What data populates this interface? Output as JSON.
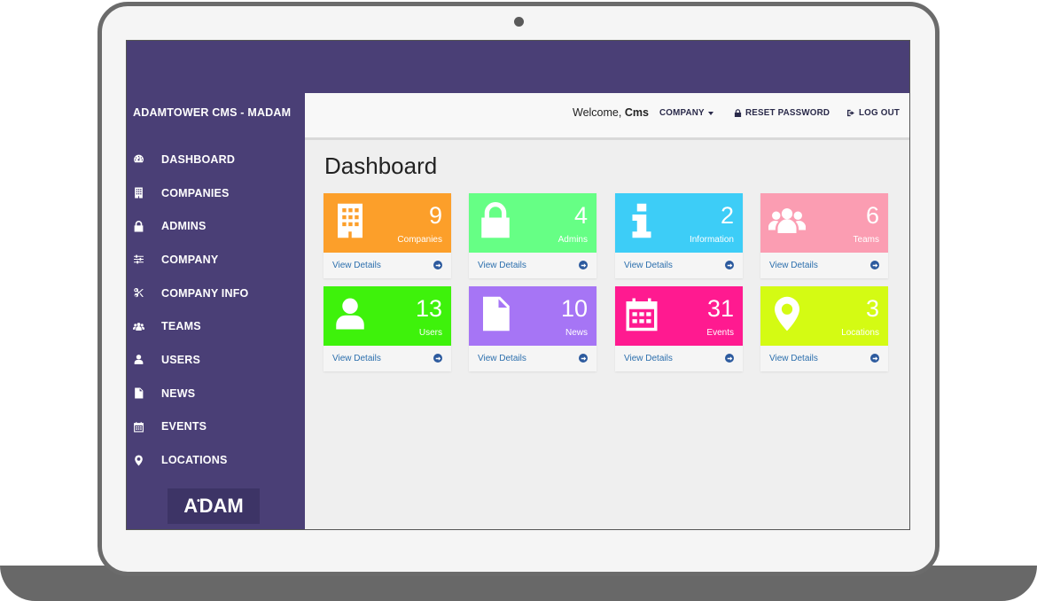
{
  "app": {
    "brand": "ADAMTOWER CMS - MADAM",
    "logo_text_left": "A",
    "logo_dot": "•",
    "logo_text_right": "DAM"
  },
  "sidebar": {
    "items": [
      {
        "label": "DASHBOARD",
        "icon": "dashboard-icon"
      },
      {
        "label": "COMPANIES",
        "icon": "building-icon"
      },
      {
        "label": "ADMINS",
        "icon": "lock-icon"
      },
      {
        "label": "COMPANY",
        "icon": "sliders-icon"
      },
      {
        "label": "COMPANY INFO",
        "icon": "scissors-icon"
      },
      {
        "label": "TEAMS",
        "icon": "users-icon"
      },
      {
        "label": "USERS",
        "icon": "user-icon"
      },
      {
        "label": "NEWS",
        "icon": "document-icon"
      },
      {
        "label": "EVENTS",
        "icon": "calendar-icon"
      },
      {
        "label": "LOCATIONS",
        "icon": "map-marker-icon"
      }
    ]
  },
  "header": {
    "welcome_prefix": "Welcome,",
    "welcome_user": "Cms",
    "company_menu": "COMPANY",
    "reset_password": "RESET PASSWORD",
    "logout": "LOG OUT"
  },
  "main": {
    "title": "Dashboard",
    "cards": [
      {
        "count": "9",
        "label": "Companies",
        "link": "View Details",
        "color": "#fc9f2a",
        "icon": "building-icon"
      },
      {
        "count": "4",
        "label": "Admins",
        "link": "View Details",
        "color": "#66ff85",
        "icon": "lock-icon"
      },
      {
        "count": "2",
        "label": "Information",
        "link": "View Details",
        "color": "#3dcdf7",
        "icon": "info-icon"
      },
      {
        "count": "6",
        "label": "Teams",
        "link": "View Details",
        "color": "#fb9db2",
        "icon": "users-icon"
      },
      {
        "count": "13",
        "label": "Users",
        "link": "View Details",
        "color": "#3ef20b",
        "icon": "user-icon"
      },
      {
        "count": "10",
        "label": "News",
        "link": "View Details",
        "color": "#a675f5",
        "icon": "document-icon"
      },
      {
        "count": "31",
        "label": "Events",
        "link": "View Details",
        "color": "#ff1a90",
        "icon": "calendar-icon"
      },
      {
        "count": "3",
        "label": "Locations",
        "link": "View Details",
        "color": "#d4fb13",
        "icon": "map-marker-icon"
      }
    ]
  }
}
